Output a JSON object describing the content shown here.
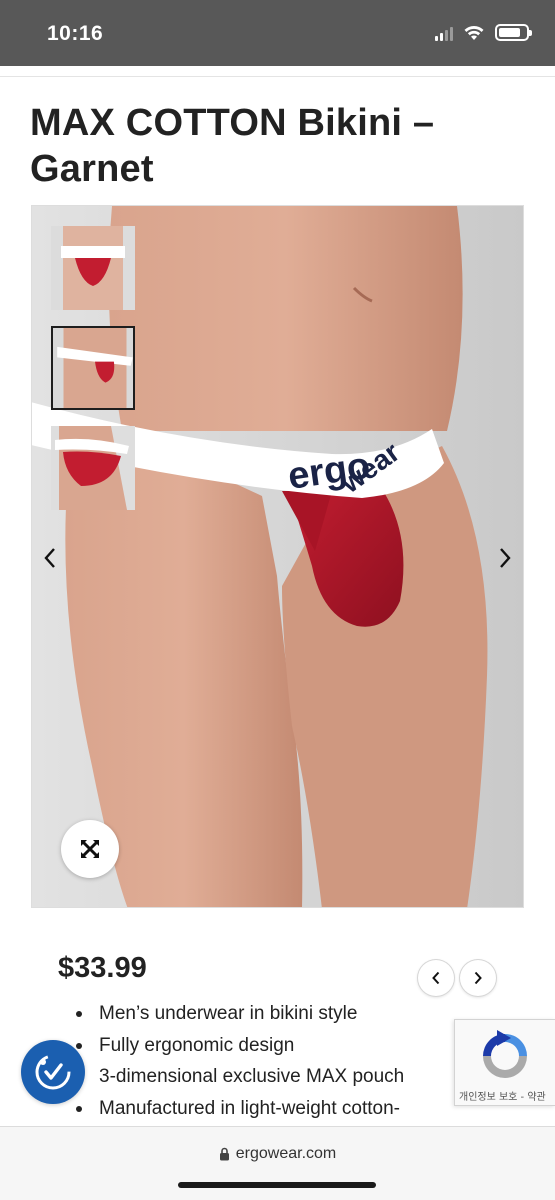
{
  "status_bar": {
    "time": "10:16",
    "icons": [
      "cellular-signal-icon",
      "wifi-icon",
      "battery-icon"
    ]
  },
  "product": {
    "title_line1": "MAX COTTON Bikini –",
    "title_line2": "Garnet",
    "price": "$33.99",
    "features": [
      "Men’s underwear in bikini style",
      "Fully ergonomic design",
      "3-dimensional exclusive MAX pouch",
      "Manufactured in light-weight cotton-"
    ],
    "brand_on_waistband_line1": "ergo",
    "brand_on_waistband_line2": "wear"
  },
  "gallery": {
    "thumbnails": 3,
    "active_thumbnail": 2,
    "icons": [
      "chevron-left-icon",
      "chevron-right-icon",
      "expand-icon"
    ]
  },
  "recaptcha": {
    "text": "개인정보 보호 - 약관"
  },
  "browser": {
    "url": "ergowear.com"
  },
  "colors": {
    "garnet": "#b5192b",
    "navy": "#1a2346",
    "accessibility_blue": "#1b5fb0",
    "status_bar": "#585858"
  }
}
